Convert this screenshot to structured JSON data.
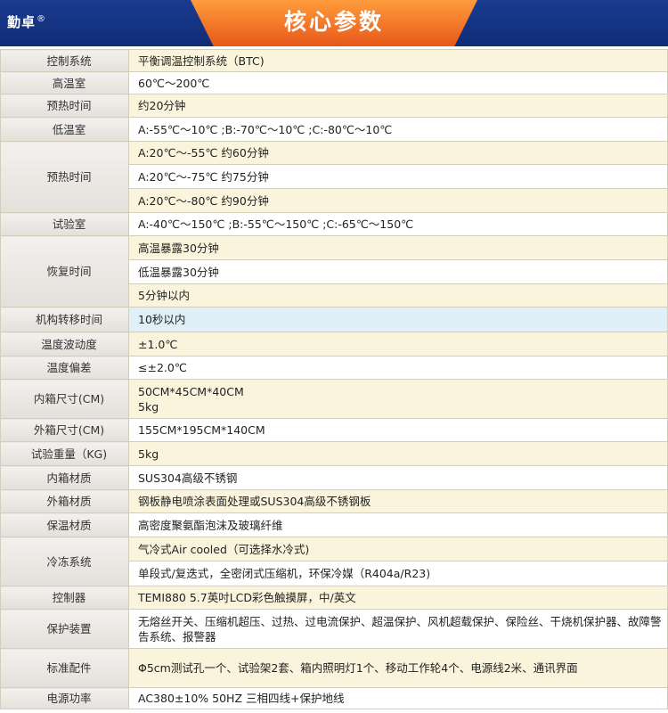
{
  "header": {
    "brand": "勤卓",
    "brand_mark": "®",
    "title": "核心参数"
  },
  "colors": {
    "banner": "#132f7c",
    "title_tab": "#f07a25",
    "row_alt": "#fbf4dc",
    "row_highlight": "#dff0f8",
    "border": "#d2cdbd"
  },
  "rows": [
    {
      "label": "控制系统",
      "values": [
        "平衡调温控制系统（BTC)"
      ]
    },
    {
      "label": "高温室",
      "values": [
        "60℃～200℃"
      ]
    },
    {
      "label": "预热时间",
      "values": [
        "约20分钟"
      ]
    },
    {
      "label": "低温室",
      "values": [
        "A:-55℃～10℃ ;B:-70℃～10℃ ;C:-80℃～10℃"
      ]
    },
    {
      "label": "预热时间",
      "values": [
        "A:20℃～-55℃ 约60分钟",
        "A:20℃～-75℃ 约75分钟",
        "A:20℃～-80℃ 约90分钟"
      ]
    },
    {
      "label": "试验室",
      "values": [
        "A:-40℃～150℃ ;B:-55℃～150℃ ;C:-65℃～150℃"
      ]
    },
    {
      "label": "恢复时间",
      "values": [
        "高温暴露30分钟",
        "低温暴露30分钟",
        "5分钟以内"
      ]
    },
    {
      "label": "机构转移时间",
      "values": [
        "10秒以内"
      ]
    },
    {
      "label": "温度波动度",
      "values": [
        "±1.0℃"
      ]
    },
    {
      "label": "温度偏差",
      "values": [
        "≤±2.0℃"
      ]
    },
    {
      "label": "内箱尺寸(CM)",
      "values": [
        "50CM*45CM*40CM\n5kg"
      ]
    },
    {
      "label": "外箱尺寸(CM)",
      "values": [
        "155CM*195CM*140CM"
      ]
    },
    {
      "label": "试验重量（KG)",
      "values": [
        "5kg"
      ]
    },
    {
      "label": "内箱材质",
      "values": [
        "SUS304高级不锈钢"
      ]
    },
    {
      "label": "外箱材质",
      "values": [
        "钢板静电喷涂表面处理或SUS304高级不锈钢板"
      ]
    },
    {
      "label": "保温材质",
      "values": [
        "高密度聚氨酯泡沫及玻璃纤维"
      ]
    },
    {
      "label": "冷冻系统",
      "values": [
        "气冷式Air cooled（可选择水冷式)",
        "单段式/复迭式，全密闭式压缩机，环保冷媒（R404a/R23)"
      ]
    },
    {
      "label": "控制器",
      "values": [
        "TEMI880 5.7英吋LCD彩色触摸屏，中/英文"
      ]
    },
    {
      "label": "保护装置",
      "values": [
        "无熔丝开关、压缩机超压、过热、过电流保护、超温保护、风机超载保护、保险丝、干烧机保护器、故障警告系统、报警器"
      ]
    },
    {
      "label": "标准配件",
      "values": [
        "Φ5cm测试孔一个、试验架2套、箱内照明灯1个、移动工作轮4个、电源线2米、通讯界面"
      ]
    },
    {
      "label": "电源功率",
      "values": [
        "AC380±10% 50HZ 三相四线+保护地线"
      ]
    }
  ]
}
